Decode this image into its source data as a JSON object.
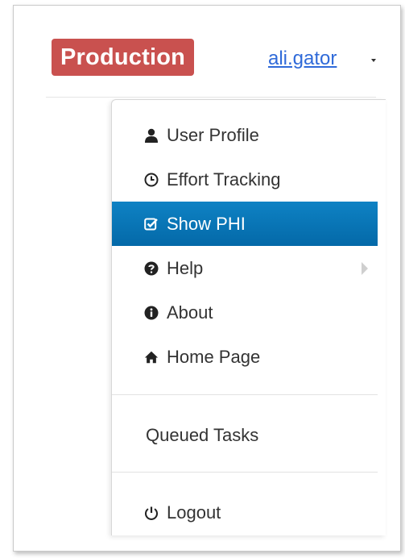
{
  "header": {
    "environment_badge": "Production",
    "username": "ali.gator"
  },
  "colors": {
    "badge_bg": "#c9514f",
    "link": "#2f6ad9",
    "active_item_bg": "#0670b2"
  },
  "menu": {
    "items": [
      {
        "label": "User Profile",
        "icon": "user-icon"
      },
      {
        "label": "Effort Tracking",
        "icon": "clock-icon"
      },
      {
        "label": "Show PHI",
        "icon": "checked-box-icon",
        "active": true
      },
      {
        "label": "Help",
        "icon": "question-circle-icon",
        "has_submenu": true
      },
      {
        "label": "About",
        "icon": "info-circle-icon"
      },
      {
        "label": "Home Page",
        "icon": "home-icon"
      }
    ],
    "queued_tasks": "Queued Tasks",
    "logout": {
      "label": "Logout",
      "icon": "power-icon"
    }
  }
}
